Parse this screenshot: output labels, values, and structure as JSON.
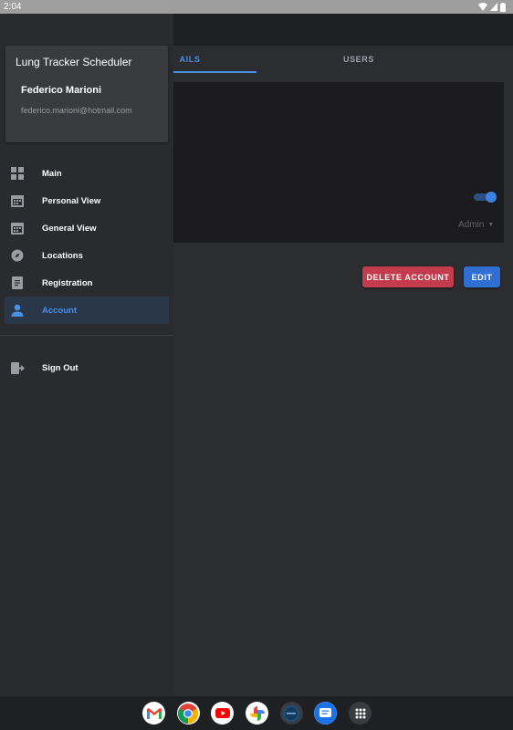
{
  "status_bar": {
    "time": "2:04"
  },
  "tabs": [
    {
      "label": "DETAILS",
      "visible_label": "AILS",
      "active": true
    },
    {
      "label": "USERS",
      "active": false
    }
  ],
  "account_details": {
    "role": "Admin",
    "toggle_on": true
  },
  "actions": {
    "delete_label": "DELETE ACCOUNT",
    "edit_label": "EDIT"
  },
  "drawer": {
    "app_name": "Lung Tracker Scheduler",
    "user_name": "Federico Marioni",
    "user_email": "federico.marioni@hotmail.com",
    "items": [
      {
        "label": "Main",
        "icon": "grid-icon"
      },
      {
        "label": "Personal View",
        "icon": "calendar-icon"
      },
      {
        "label": "General View",
        "icon": "calendar-icon"
      },
      {
        "label": "Locations",
        "icon": "compass-icon"
      },
      {
        "label": "Registration",
        "icon": "document-icon"
      },
      {
        "label": "Account",
        "icon": "person-icon",
        "active": true
      }
    ],
    "sign_out_label": "Sign Out"
  },
  "dock": {
    "apps": [
      "gmail-icon",
      "chrome-icon",
      "youtube-icon",
      "photos-icon",
      "scheduler-app-icon",
      "messages-icon",
      "app-drawer-icon"
    ]
  },
  "colors": {
    "accent": "#4a8fe6",
    "danger": "#c33b4c",
    "primary_button": "#2f6fd3",
    "drawer_bg": "#2a2b2f",
    "page_bg": "#2c2d31"
  }
}
